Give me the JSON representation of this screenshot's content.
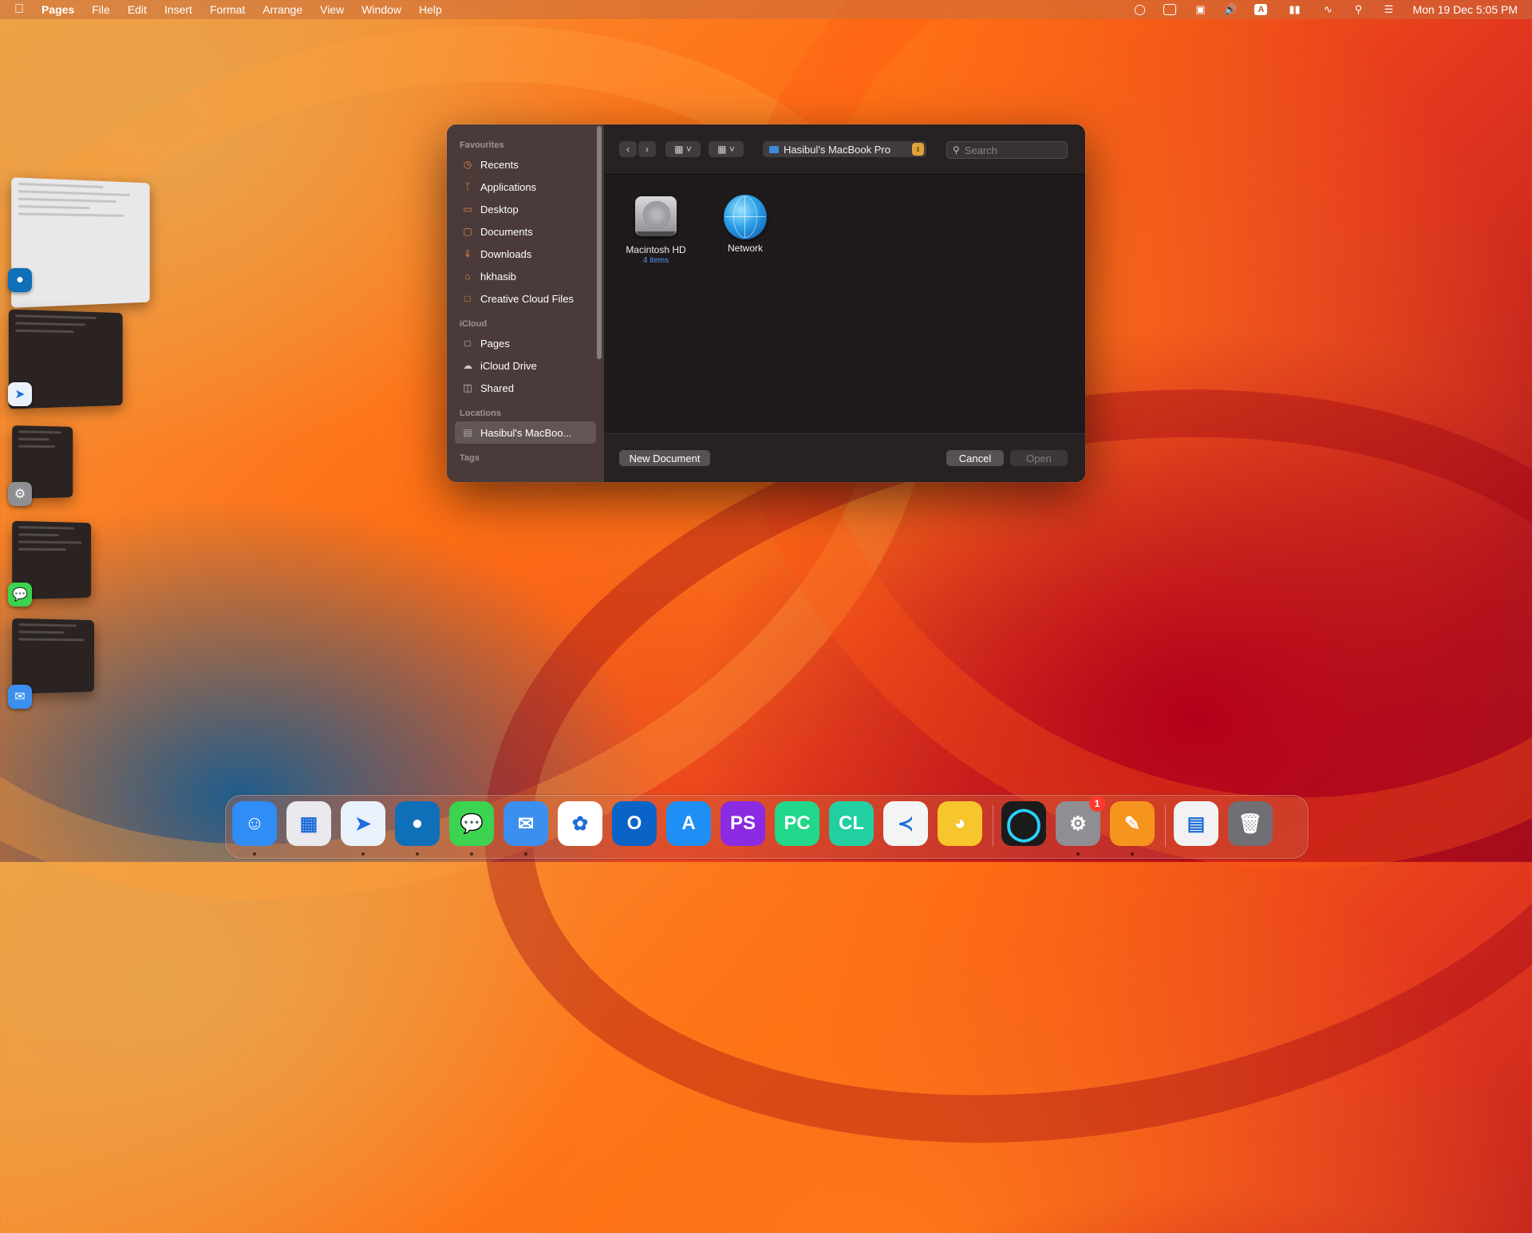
{
  "menubar": {
    "app": "Pages",
    "menus": [
      "File",
      "Edit",
      "Insert",
      "Format",
      "Arrange",
      "View",
      "Window",
      "Help"
    ],
    "status_icons": [
      "focus-icon",
      "display-icon",
      "screen-mirroring-icon",
      "volume-icon",
      "input-source-icon",
      "battery-icon",
      "wifi-icon",
      "spotlight-icon",
      "control-center-icon"
    ],
    "input_source": "A",
    "clock": "Mon 19 Dec  5:05 PM"
  },
  "stage_manager": {
    "apps": [
      "edge-icon",
      "safari-icon",
      "system-settings-icon",
      "messages-icon",
      "mail-icon"
    ]
  },
  "dialog": {
    "sidebar": {
      "sections": [
        {
          "title": "Favourites",
          "items": [
            {
              "label": "Recents",
              "icon": "clock-icon"
            },
            {
              "label": "Applications",
              "icon": "applications-icon"
            },
            {
              "label": "Desktop",
              "icon": "desktop-icon"
            },
            {
              "label": "Documents",
              "icon": "document-icon"
            },
            {
              "label": "Downloads",
              "icon": "download-icon"
            },
            {
              "label": "hkhasib",
              "icon": "home-icon"
            },
            {
              "label": "Creative Cloud Files",
              "icon": "file-icon"
            }
          ]
        },
        {
          "title": "iCloud",
          "items": [
            {
              "label": "Pages",
              "icon": "folder-icon"
            },
            {
              "label": "iCloud Drive",
              "icon": "cloud-icon"
            },
            {
              "label": "Shared",
              "icon": "shared-folder-icon"
            }
          ]
        },
        {
          "title": "Locations",
          "items": [
            {
              "label": "Hasibul's MacBoo...",
              "icon": "laptop-icon",
              "selected": true
            }
          ]
        },
        {
          "title": "Tags",
          "items": []
        }
      ]
    },
    "toolbar": {
      "location": "Hasibul's MacBook Pro",
      "search_placeholder": "Search"
    },
    "items": [
      {
        "name": "Macintosh HD",
        "sub": "4 items",
        "icon": "hard-drive-icon"
      },
      {
        "name": "Network",
        "sub": "",
        "icon": "network-globe-icon"
      }
    ],
    "buttons": {
      "new_document": "New Document",
      "cancel": "Cancel",
      "open": "Open"
    }
  },
  "dock": {
    "apps": [
      {
        "name": "Finder",
        "icon": "finder-icon",
        "running": true,
        "color": "#2f8df5"
      },
      {
        "name": "Launchpad",
        "icon": "launchpad-icon",
        "running": false,
        "color": "#e9e9ee"
      },
      {
        "name": "Safari",
        "icon": "safari-icon",
        "running": true,
        "color": "#e9f2fb"
      },
      {
        "name": "Microsoft Edge",
        "icon": "edge-icon",
        "running": true,
        "color": "#0f6fb8"
      },
      {
        "name": "Messages",
        "icon": "messages-icon",
        "running": true,
        "color": "#3bd34f"
      },
      {
        "name": "Mail",
        "icon": "mail-icon",
        "running": true,
        "color": "#3b8fef"
      },
      {
        "name": "Photos",
        "icon": "photos-icon",
        "running": false,
        "color": "#ffffff"
      },
      {
        "name": "Outlook",
        "icon": "outlook-icon",
        "running": false,
        "color": "#0a64c8"
      },
      {
        "name": "App Store",
        "icon": "app-store-icon",
        "running": false,
        "color": "#1e8ff5"
      },
      {
        "name": "PhpStorm",
        "icon": "phpstorm-icon",
        "running": false,
        "color": "#8a2be2",
        "text": "PS"
      },
      {
        "name": "PyCharm",
        "icon": "pycharm-icon",
        "running": false,
        "color": "#21d789",
        "text": "PC"
      },
      {
        "name": "CLion",
        "icon": "clion-icon",
        "running": false,
        "color": "#22cfa3",
        "text": "CL"
      },
      {
        "name": "Visual Studio Code",
        "icon": "vscode-icon",
        "running": false,
        "color": "#f4f4f4"
      },
      {
        "name": "Cyberduck",
        "icon": "cyberduck-icon",
        "running": false,
        "color": "#f7c52c"
      },
      {
        "name": "Ring App",
        "icon": "ring-app-icon",
        "running": false,
        "color": "#1b1b1b"
      },
      {
        "name": "System Settings",
        "icon": "system-settings-icon",
        "running": true,
        "color": "#8e8e93",
        "badge": "1"
      },
      {
        "name": "Pages",
        "icon": "pages-icon",
        "running": true,
        "color": "#f7941d"
      },
      {
        "name": "Document",
        "icon": "document-stack-icon",
        "running": false,
        "color": "#f2f2f2"
      },
      {
        "name": "Trash",
        "icon": "trash-icon",
        "running": false,
        "color": "#6f6f74"
      }
    ]
  }
}
